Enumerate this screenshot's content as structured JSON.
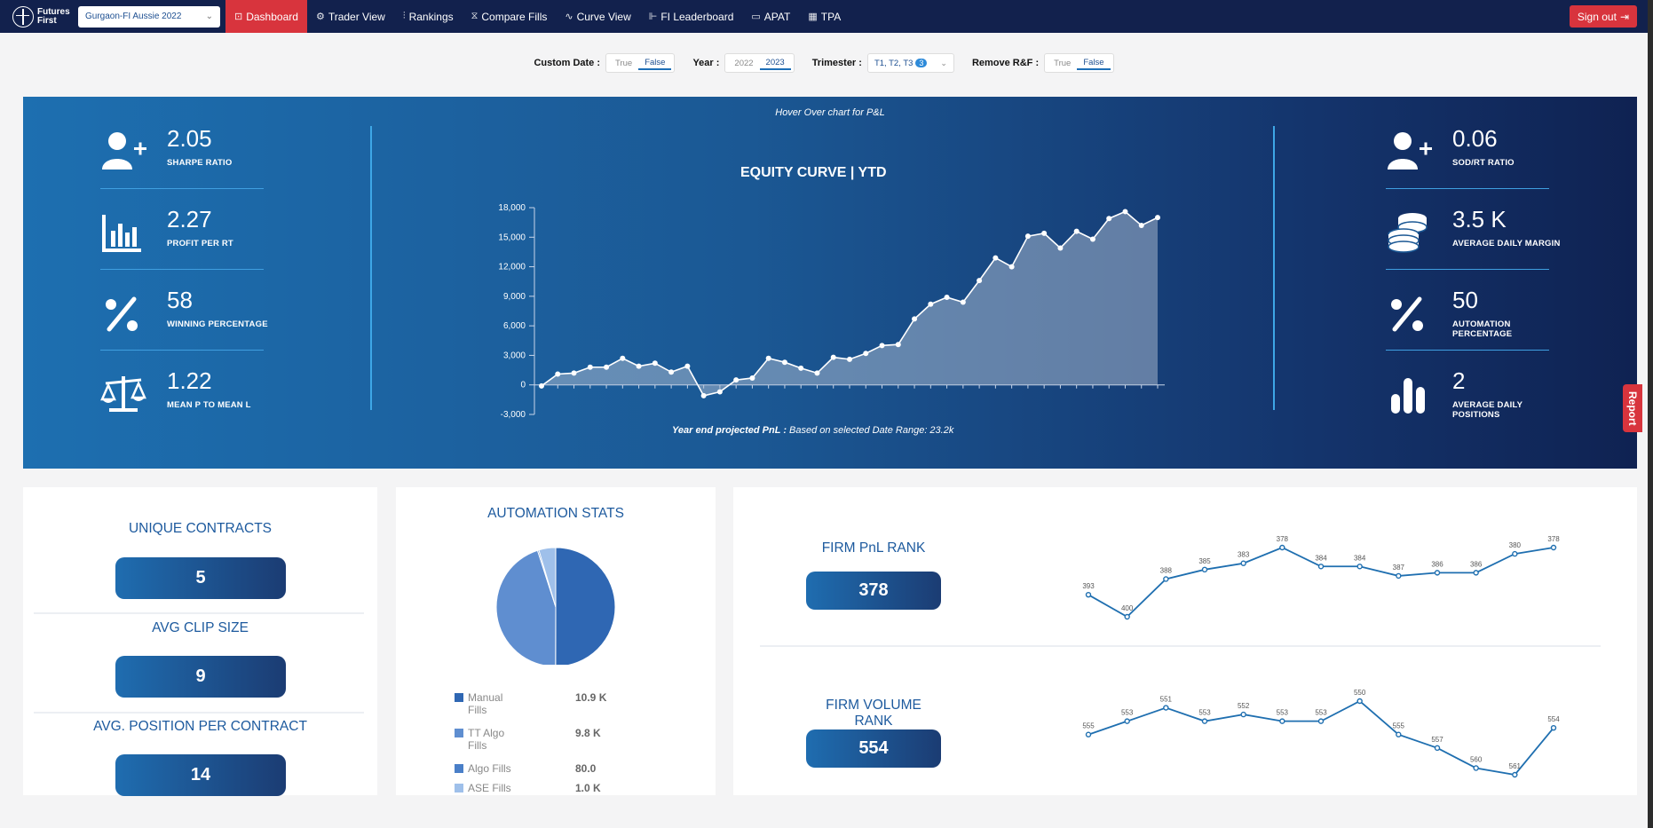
{
  "nav": {
    "logo_text": "Futures First",
    "office_select": "Gurgaon-FI Aussie 2022",
    "items": [
      {
        "icon": "dashboard-icon",
        "glyph": "⊡",
        "label": "Dashboard"
      },
      {
        "icon": "trader-icon",
        "glyph": "⚙",
        "label": "Trader View"
      },
      {
        "icon": "rankings-icon",
        "glyph": "⫶",
        "label": "Rankings"
      },
      {
        "icon": "hourglass-icon",
        "glyph": "⧖",
        "label": "Compare Fills"
      },
      {
        "icon": "curve-icon",
        "glyph": "∿",
        "label": "Curve View"
      },
      {
        "icon": "leaderboard-icon",
        "glyph": "⊩",
        "label": "FI Leaderboard"
      },
      {
        "icon": "monitor-icon",
        "glyph": "▭",
        "label": "APAT"
      },
      {
        "icon": "table-icon",
        "glyph": "▦",
        "label": "TPA"
      }
    ],
    "signout": "Sign out"
  },
  "filters": {
    "custom_date": {
      "label": "Custom Date :",
      "options": [
        "True",
        "False"
      ],
      "selected": "False"
    },
    "year": {
      "label": "Year :",
      "options": [
        "2022",
        "2023"
      ],
      "selected": "2023"
    },
    "trimester": {
      "label": "Trimester :",
      "value": "T1, T2, T3",
      "count": "3"
    },
    "remove_rf": {
      "label": "Remove R&F :",
      "options": [
        "True",
        "False"
      ],
      "selected": "False"
    }
  },
  "hero": {
    "hover_note": "Hover Over chart for P&L",
    "left_kpis": [
      {
        "icon": "user-plus-icon",
        "value": "2.05",
        "label": "SHARPE RATIO"
      },
      {
        "icon": "bar-chart-icon",
        "value": "2.27",
        "label": "PROFIT PER RT"
      },
      {
        "icon": "percent-icon",
        "value": "58",
        "label": "WINNING PERCENTAGE"
      },
      {
        "icon": "balance-scale-icon",
        "value": "1.22",
        "label": "MEAN P TO MEAN L"
      }
    ],
    "right_kpis": [
      {
        "icon": "user-plus-icon",
        "value": "0.06",
        "label": "SOD/RT RATIO"
      },
      {
        "icon": "coins-icon",
        "value": "3.5 K",
        "label": "AVERAGE DAILY MARGIN"
      },
      {
        "icon": "percent-icon",
        "value": "50",
        "label": "AUTOMATION PERCENTAGE"
      },
      {
        "icon": "bars-icon",
        "value": "2",
        "label": "AVERAGE DAILY POSITIONS"
      }
    ],
    "projected_label": "Year end projected PnL :",
    "projected_text": "Based on selected Date Range: 23.2k"
  },
  "chart_data": [
    {
      "type": "area",
      "title": "EQUITY CURVE | YTD",
      "ylim": [
        -3000,
        18000
      ],
      "yticks": [
        "-3,000",
        "0",
        "3,000",
        "6,000",
        "9,000",
        "12,000",
        "15,000",
        "18,000"
      ],
      "ytick_values": [
        -3000,
        0,
        3000,
        6000,
        9000,
        12000,
        15000,
        18000
      ],
      "values": [
        -100,
        1100,
        1200,
        1800,
        1800,
        2700,
        1900,
        2200,
        1300,
        1900,
        -1100,
        -700,
        500,
        700,
        2700,
        2300,
        1700,
        1200,
        2800,
        2600,
        3200,
        4000,
        4100,
        6700,
        8200,
        8900,
        8400,
        10600,
        12900,
        12000,
        15100,
        15400,
        13900,
        15600,
        14800,
        16900,
        17600,
        16200,
        17000
      ],
      "grid": false,
      "legend": "none"
    },
    {
      "type": "pie",
      "title": "AUTOMATION STATS",
      "slices": [
        {
          "label": "Manual Fills",
          "display": "10.9 K",
          "value": 10900,
          "color": "#2f67b3"
        },
        {
          "label": "TT Algo Fills",
          "display": "9.8 K",
          "value": 9800,
          "color": "#5f8ed0"
        },
        {
          "label": "Algo Fills",
          "display": "80.0",
          "value": 80,
          "color": "#4a7fc8"
        },
        {
          "label": "ASE Fills",
          "display": "1.0 K",
          "value": 1000,
          "color": "#9fc0ea"
        }
      ],
      "legend": "bottom"
    },
    {
      "type": "line",
      "title": "FIRM PnL RANK",
      "current": "378",
      "values": [
        393,
        400,
        388,
        385,
        383,
        378,
        384,
        384,
        387,
        386,
        386,
        380,
        378
      ],
      "inverted": true,
      "color": "#1f6fb0"
    },
    {
      "type": "line",
      "title": "FIRM VOLUME RANK",
      "current": "554",
      "values": [
        555,
        553,
        551,
        553,
        552,
        553,
        553,
        550,
        555,
        557,
        560,
        561,
        554
      ],
      "inverted": true,
      "color": "#1f6fb0"
    }
  ],
  "contracts": {
    "unique_title": "UNIQUE CONTRACTS",
    "unique_value": "5",
    "clip_title": "AVG CLIP SIZE",
    "clip_value": "9",
    "avg_pos_title": "AVG. POSITION PER CONTRACT",
    "avg_pos_value": "14"
  },
  "report_tab": "Report"
}
